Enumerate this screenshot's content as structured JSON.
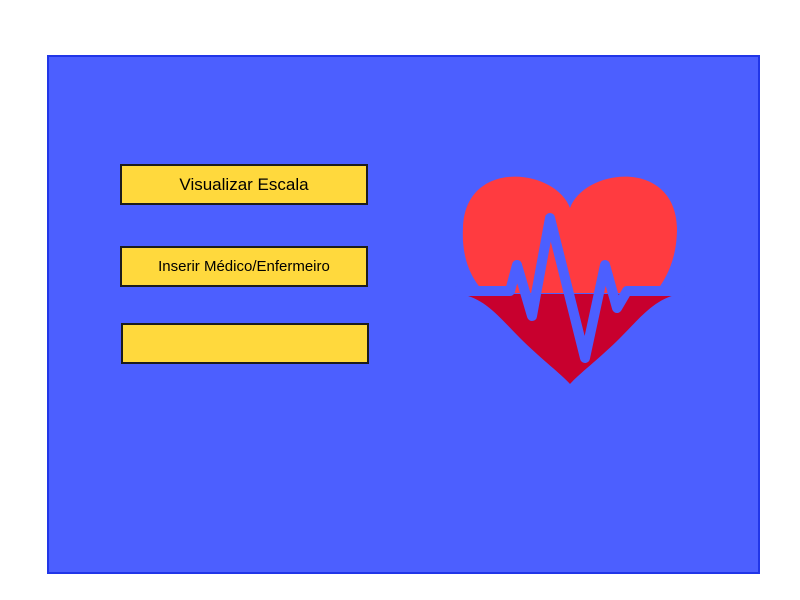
{
  "panel": {
    "background_color": "#4c5fff",
    "border_color": "#2136e8"
  },
  "menu": {
    "buttons": [
      {
        "label": "Visualizar Escala"
      },
      {
        "label": "Inserir Médico/Enfermeiro"
      },
      {
        "label": ""
      }
    ],
    "button_color": "#ffd93d"
  },
  "logo": {
    "icon": "heart-pulse-icon",
    "heart_color": "#ff3b40",
    "lower_color": "#c8002e",
    "pulse_color": "#4c5fff"
  }
}
